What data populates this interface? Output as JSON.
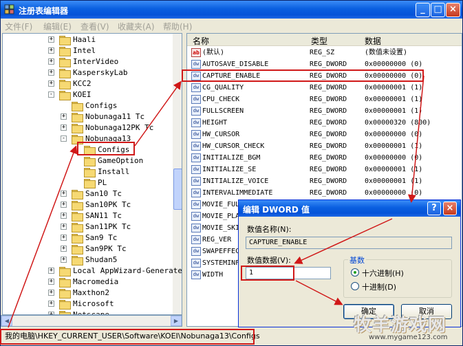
{
  "window": {
    "title": "注册表编辑器",
    "controls": [
      "_",
      "□",
      "×"
    ]
  },
  "menu": [
    "文件(F)",
    "编辑(E)",
    "查看(V)",
    "收藏夹(A)",
    "帮助(H)"
  ],
  "tree": [
    {
      "label": "Haali",
      "exp": "+",
      "indent": 0
    },
    {
      "label": "Intel",
      "exp": "+",
      "indent": 0
    },
    {
      "label": "InterVideo",
      "exp": "+",
      "indent": 0
    },
    {
      "label": "KasperskyLab",
      "exp": "+",
      "indent": 0
    },
    {
      "label": "KCC2",
      "exp": "+",
      "indent": 0
    },
    {
      "label": "KOEI",
      "exp": "-",
      "indent": 0
    },
    {
      "label": "Configs",
      "exp": "",
      "indent": 1
    },
    {
      "label": "Nobunaga11 Tc",
      "exp": "+",
      "indent": 1
    },
    {
      "label": "Nobunaga12PK Tc",
      "exp": "+",
      "indent": 1
    },
    {
      "label": "Nobunaga13",
      "exp": "-",
      "indent": 1
    },
    {
      "label": "Configs",
      "exp": "",
      "indent": 2
    },
    {
      "label": "GameOption",
      "exp": "",
      "indent": 2
    },
    {
      "label": "Install",
      "exp": "",
      "indent": 2
    },
    {
      "label": "PL",
      "exp": "",
      "indent": 2
    },
    {
      "label": "San10 Tc",
      "exp": "+",
      "indent": 1
    },
    {
      "label": "San10PK Tc",
      "exp": "+",
      "indent": 1
    },
    {
      "label": "SAN11 Tc",
      "exp": "+",
      "indent": 1
    },
    {
      "label": "San11PK Tc",
      "exp": "+",
      "indent": 1
    },
    {
      "label": "San9 Tc",
      "exp": "+",
      "indent": 1
    },
    {
      "label": "San9PK Tc",
      "exp": "+",
      "indent": 1
    },
    {
      "label": "Shudan5",
      "exp": "+",
      "indent": 1
    },
    {
      "label": "Local AppWizard-Generate",
      "exp": "+",
      "indent": 0
    },
    {
      "label": "Macromedia",
      "exp": "+",
      "indent": 0
    },
    {
      "label": "Maxthon2",
      "exp": "+",
      "indent": 0
    },
    {
      "label": "Microsoft",
      "exp": "+",
      "indent": 0
    },
    {
      "label": "Netscape",
      "exp": "+",
      "indent": 0
    }
  ],
  "list_headers": {
    "name": "名称",
    "type": "类型",
    "data": "数据"
  },
  "values": [
    {
      "icon": "ab",
      "name": "(默认)",
      "type": "REG_SZ",
      "data": "(数值未设置)"
    },
    {
      "icon": "dw",
      "name": "AUTOSAVE_DISABLE",
      "type": "REG_DWORD",
      "data": "0x00000000 (0)"
    },
    {
      "icon": "dw",
      "name": "CAPTURE_ENABLE",
      "type": "REG_DWORD",
      "data": "0x00000000 (0)"
    },
    {
      "icon": "dw",
      "name": "CG_QUALITY",
      "type": "REG_DWORD",
      "data": "0x00000001 (1)"
    },
    {
      "icon": "dw",
      "name": "CPU_CHECK",
      "type": "REG_DWORD",
      "data": "0x00000001 (1)"
    },
    {
      "icon": "dw",
      "name": "FULLSCREEN",
      "type": "REG_DWORD",
      "data": "0x00000001 (1)"
    },
    {
      "icon": "dw",
      "name": "HEIGHT",
      "type": "REG_DWORD",
      "data": "0x00000320 (800)"
    },
    {
      "icon": "dw",
      "name": "HW_CURSOR",
      "type": "REG_DWORD",
      "data": "0x00000000 (0)"
    },
    {
      "icon": "dw",
      "name": "HW_CURSOR_CHECK",
      "type": "REG_DWORD",
      "data": "0x00000001 (1)"
    },
    {
      "icon": "dw",
      "name": "INITIALIZE_BGM",
      "type": "REG_DWORD",
      "data": "0x00000000 (0)"
    },
    {
      "icon": "dw",
      "name": "INITIALIZE_SE",
      "type": "REG_DWORD",
      "data": "0x00000001 (1)"
    },
    {
      "icon": "dw",
      "name": "INITIALIZE_VOICE",
      "type": "REG_DWORD",
      "data": "0x00000001 (1)"
    },
    {
      "icon": "dw",
      "name": "INTERVALIMMEDIATE",
      "type": "REG_DWORD",
      "data": "0x00000000 (0)"
    },
    {
      "icon": "dw",
      "name": "MOVIE_FUL",
      "type": "",
      "data": ""
    },
    {
      "icon": "dw",
      "name": "MOVIE_PLA",
      "type": "",
      "data": ""
    },
    {
      "icon": "dw",
      "name": "MOVIE_SKI",
      "type": "",
      "data": ""
    },
    {
      "icon": "dw",
      "name": "REG_VER",
      "type": "",
      "data": ""
    },
    {
      "icon": "dw",
      "name": "SWAPEFFEC",
      "type": "",
      "data": ""
    },
    {
      "icon": "dw",
      "name": "SYSTEMINF",
      "type": "",
      "data": ""
    },
    {
      "icon": "dw",
      "name": "WIDTH",
      "type": "",
      "data": ""
    }
  ],
  "status_path": "我的电脑\\HKEY_CURRENT_USER\\Software\\KOEI\\Nobunaga13\\Configs",
  "dialog": {
    "title": "编辑 DWORD 值",
    "name_label": "数值名称(N):",
    "name_value": "CAPTURE_ENABLE",
    "data_label": "数值数据(V):",
    "data_value": "1",
    "base_label": "基数",
    "hex_label": "十六进制(H)",
    "dec_label": "十进制(D)",
    "ok_label": "确定",
    "cancel_label": "取消",
    "help_label": "?",
    "close_label": "×"
  },
  "watermark": {
    "text": "牧羊游戏网",
    "url": "www.mygame123.com"
  },
  "colors": {
    "annotation": "#d01818",
    "titlebar": "#0a5fe0"
  }
}
